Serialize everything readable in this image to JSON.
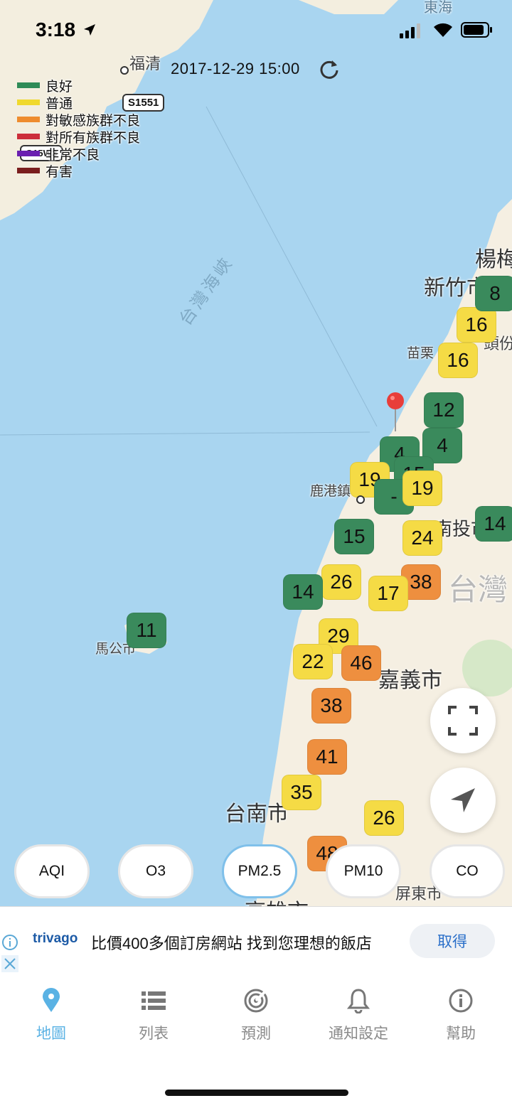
{
  "status_bar": {
    "time": "3:18"
  },
  "map": {
    "timestamp": "2017-12-29 15:00",
    "legend": [
      {
        "label": "良好",
        "color": "#2e8b57"
      },
      {
        "label": "普通",
        "color": "#f0d92e"
      },
      {
        "label": "對敏感族群不良",
        "color": "#ee8c2e"
      },
      {
        "label": "對所有族群不良",
        "color": "#cc2e3a"
      },
      {
        "label": "非常不良",
        "color": "#6a1fb0"
      },
      {
        "label": "有害",
        "color": "#7a1e1e"
      }
    ],
    "labels": {
      "fuqing": "福清",
      "road1": "S1551",
      "road2": "G15W3",
      "strait": "台灣海峽",
      "hsinchu": "新竹市",
      "yangmei": "楊梅",
      "toufen": "頭份",
      "miaoli": "苗栗",
      "lukang": "鹿港鎮",
      "nantou": "南投市",
      "taiwan": "台灣",
      "chiayi": "嘉義市",
      "magong": "馬公市",
      "tainan": "台南市",
      "kaohsiung": "高雄市",
      "pingtung": "屏東市",
      "top_edge": "東海"
    },
    "markers": [
      {
        "value": "16",
        "level": "moderate"
      },
      {
        "value": "16",
        "level": "moderate"
      },
      {
        "value": "8",
        "level": "good"
      },
      {
        "value": "12",
        "level": "good"
      },
      {
        "value": "4",
        "level": "good"
      },
      {
        "value": "4",
        "level": "good"
      },
      {
        "value": "15",
        "level": "good"
      },
      {
        "value": "19",
        "level": "moderate"
      },
      {
        "value": "-",
        "level": "good"
      },
      {
        "value": "19",
        "level": "moderate"
      },
      {
        "value": "14",
        "level": "good"
      },
      {
        "value": "15",
        "level": "good"
      },
      {
        "value": "24",
        "level": "moderate"
      },
      {
        "value": "38",
        "level": "sensitive"
      },
      {
        "value": "26",
        "level": "moderate"
      },
      {
        "value": "14",
        "level": "good"
      },
      {
        "value": "17",
        "level": "moderate"
      },
      {
        "value": "11",
        "level": "good"
      },
      {
        "value": "29",
        "level": "moderate"
      },
      {
        "value": "22",
        "level": "moderate"
      },
      {
        "value": "46",
        "level": "sensitive"
      },
      {
        "value": "38",
        "level": "sensitive"
      },
      {
        "value": "41",
        "level": "sensitive"
      },
      {
        "value": "35",
        "level": "moderate"
      },
      {
        "value": "26",
        "level": "moderate"
      },
      {
        "value": "48",
        "level": "sensitive"
      }
    ]
  },
  "pollutants": [
    {
      "label": "AQI",
      "selected": false
    },
    {
      "label": "O3",
      "selected": false
    },
    {
      "label": "PM2.5",
      "selected": true
    },
    {
      "label": "PM10",
      "selected": false
    },
    {
      "label": "CO",
      "selected": false
    }
  ],
  "ad": {
    "logo": "trivago",
    "text": "比價400多個訂房網站 找到您理想的飯店",
    "button": "取得"
  },
  "tabs": [
    {
      "label": "地圖",
      "icon": "map-pin-icon",
      "active": true
    },
    {
      "label": "列表",
      "icon": "list-icon",
      "active": false
    },
    {
      "label": "預測",
      "icon": "forecast-radar-icon",
      "active": false
    },
    {
      "label": "通知設定",
      "icon": "bell-icon",
      "active": false
    },
    {
      "label": "幫助",
      "icon": "info-icon",
      "active": false
    }
  ],
  "colors": {
    "accent": "#5ab2e4",
    "sea": "#a9d5f0",
    "land": "#f5efe2",
    "good": "#3a8a5c",
    "moderate": "#f5db45",
    "sensitive": "#ee8f3f"
  }
}
